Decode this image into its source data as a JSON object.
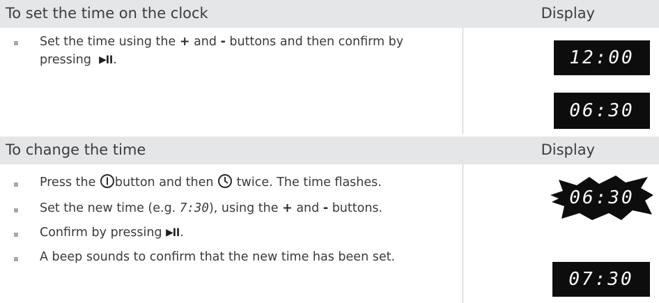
{
  "section1": {
    "title": "To set the time on the clock",
    "display_header": "Display",
    "text_a": "Set the time using the",
    "plus": "+",
    "and": "and",
    "minus": "-",
    "text_b": "buttons and then confirm by",
    "text_c": "pressing",
    "period": ".",
    "displays": [
      "12:00",
      "06:30"
    ]
  },
  "section2": {
    "title": "To change the time",
    "display_header": "Display",
    "b1_a": "Press the",
    "b1_b": "button and then",
    "b1_c": "twice. The time flashes.",
    "b2_a": "Set the new time (e.g.",
    "b2_time": "7:30",
    "b2_b": "), using the",
    "b2_plus": "+",
    "b2_and": "and",
    "b2_minus": "-",
    "b2_c": "buttons.",
    "b3": "Confirm by pressing",
    "b3_period": ".",
    "b4": "A beep sounds to confirm that the new time has been set.",
    "displays": [
      "06:30",
      "07:30"
    ]
  },
  "icons": {
    "play_pause": "play-pause-icon",
    "power": "power-icon",
    "clock": "clock-icon"
  },
  "colors": {
    "header_bg": "#e5e6e8",
    "bullet": "#a7a9ac",
    "display_bg": "#0d0d0d"
  }
}
